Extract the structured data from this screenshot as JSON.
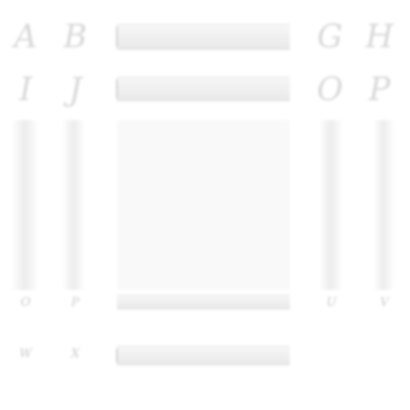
{
  "glyphs": {
    "row1": [
      "A",
      "B",
      "G",
      "H"
    ],
    "row2": [
      "I",
      "J",
      "O",
      "P"
    ],
    "row3": [
      "O",
      "P",
      "U",
      "V"
    ],
    "row4": [
      "W",
      "X"
    ]
  },
  "colors": {
    "glyph": "#d8d8d8",
    "bar": "#ececec",
    "panel": "#f9f9f9"
  }
}
